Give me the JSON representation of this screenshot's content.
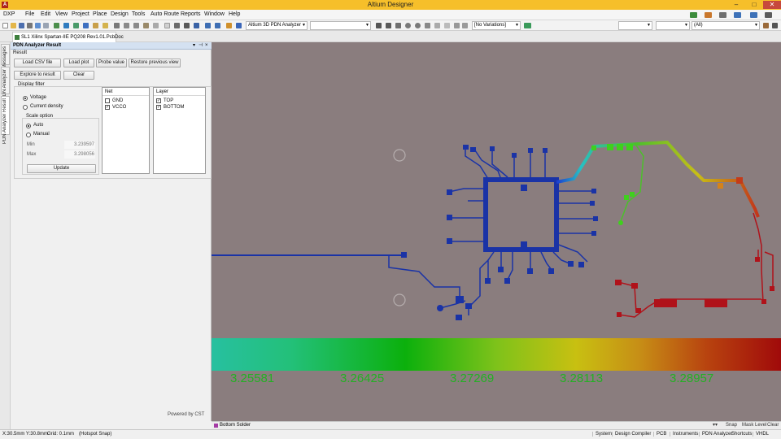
{
  "window": {
    "title": "Altium Designer",
    "app_icon": "A"
  },
  "menu": {
    "items": [
      "DXP",
      "File",
      "Edit",
      "View",
      "Project",
      "Place",
      "Design",
      "Tools",
      "Auto Route",
      "Reports",
      "Window",
      "Help"
    ]
  },
  "toolbar": {
    "view_combo": "Altium 3D PDN Analyzer",
    "variations_combo": "[No Variations]",
    "filter_combo": "(All)"
  },
  "document": {
    "tab": "SL1 Xilinx Spartan-IIE PQ208 Rev1.01.PcbDoc"
  },
  "side_tabs": [
    "Messages",
    "PDN Analyzer",
    "PDN Analyzer Result"
  ],
  "panel": {
    "title": "PDN Analyzer Result",
    "section_result": "Result",
    "buttons": {
      "load_csv": "Load CSV file",
      "load_plot": "Load plot",
      "probe_value": "Probe value",
      "restore_view": "Restore previous view",
      "explore": "Explore to result",
      "clear": "Clear",
      "update": "Update"
    },
    "display_filter": "Display filter",
    "radio_voltage": "Voltage",
    "radio_current": "Current density",
    "scale_option": "Scale option",
    "radio_auto": "Auto",
    "radio_manual": "Manual",
    "min_label": "Min",
    "min_value": "3.239597",
    "max_label": "Max",
    "max_value": "3.298056",
    "net_header": "Net",
    "nets": [
      {
        "name": "GND",
        "checked": false
      },
      {
        "name": "VCCO",
        "checked": true
      }
    ],
    "layer_header": "Layer",
    "layers": [
      {
        "name": "TOP",
        "checked": true
      },
      {
        "name": "BOTTOM",
        "checked": true
      }
    ],
    "powered_by": "Powered by CST"
  },
  "colors": {
    "title_bar": "#f6bf2a",
    "canvas_bg": "#8a7d7e",
    "trace_blue": "#1a33a6",
    "trace_red": "#b0121a",
    "scale_text": "#23b023"
  },
  "scale": {
    "labels": [
      "3.25581",
      "3.26425",
      "3.27269",
      "3.28113",
      "3.28957"
    ]
  },
  "layer_strip": {
    "active_layer": "Bottom Solder",
    "snap": "Snap",
    "mask_level": "Mask Level",
    "clear": "Clear"
  },
  "status": {
    "coords": "X:30.5mm Y:30.8mm",
    "grid": "Grid: 0.1mm",
    "snap": "(Hotspot Snap)",
    "right_items": [
      "System",
      "Design Compiler",
      "PCB",
      "Instruments",
      "PDN Analyzer",
      "Shortcuts",
      "VHDL"
    ]
  }
}
